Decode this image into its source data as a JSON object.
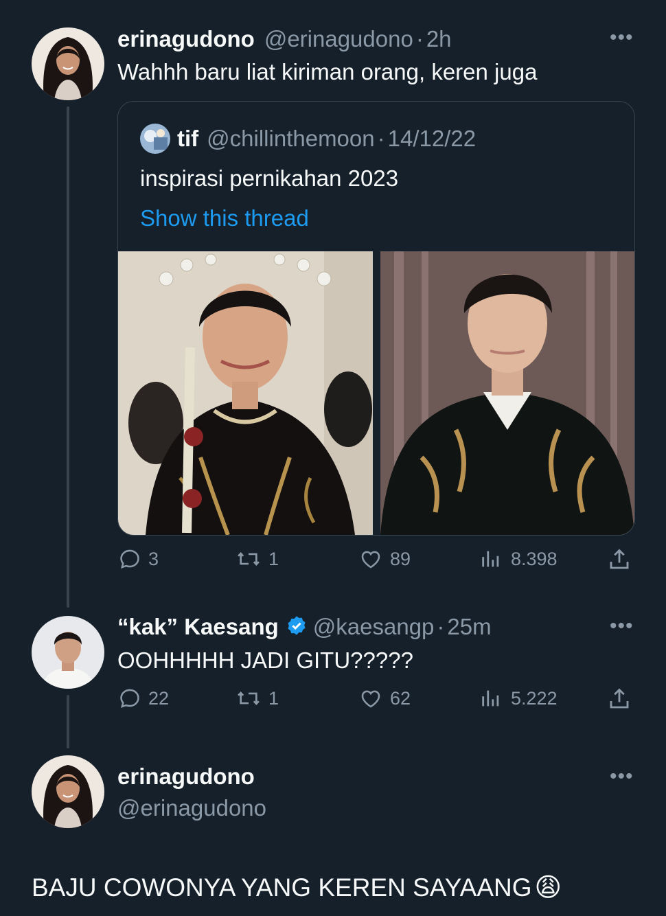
{
  "tweet1": {
    "name": "erinagudono",
    "handle": "@erinagudono",
    "separator": "·",
    "time": "2h",
    "text": "Wahhh baru liat kiriman orang, keren juga",
    "quote": {
      "name": "tif",
      "handle": "@chillinthemoon",
      "separator": "·",
      "date": "14/12/22",
      "text": "inspirasi pernikahan 2023",
      "show_thread": "Show this thread"
    },
    "stats": {
      "replies": "3",
      "retweets": "1",
      "likes": "89",
      "views": "8.398"
    }
  },
  "tweet2": {
    "name": "“kak” Kaesang",
    "handle": "@kaesangp",
    "separator": "·",
    "time": "25m",
    "text": "OOHHHHH JADI GITU?????",
    "stats": {
      "replies": "22",
      "retweets": "1",
      "likes": "62",
      "views": "5.222"
    }
  },
  "tweet3": {
    "name": "erinagudono",
    "handle": "@erinagudono",
    "text": "BAJU COWONYA YANG KEREN SAYAANG",
    "emoji": "😩"
  },
  "colors": {
    "background": "#15202b",
    "text": "#f7f9f9",
    "secondary": "#8b98a5",
    "link": "#1d9bf0",
    "border": "#38444d"
  },
  "icons": [
    "reply-icon",
    "retweet-icon",
    "like-icon",
    "views-icon",
    "share-icon",
    "more-icon",
    "verified-icon"
  ]
}
